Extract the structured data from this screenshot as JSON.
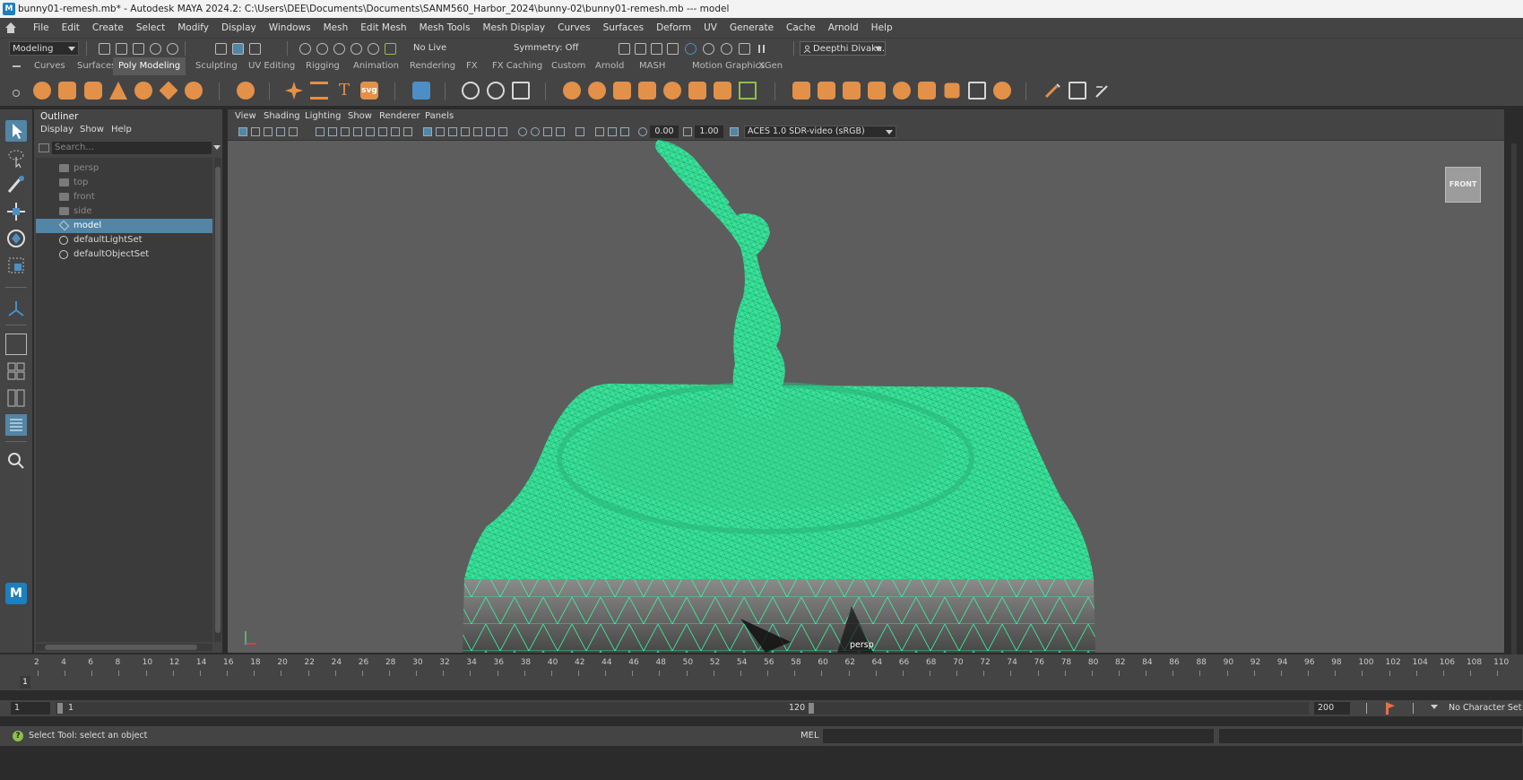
{
  "window": {
    "title": "bunny01-remesh.mb* - Autodesk MAYA 2024.2: C:\\Users\\DEE\\Documents\\Documents\\SANM560_Harbor_2024\\bunny-02\\bunny01-remesh.mb   ---   model"
  },
  "menubar": {
    "items": [
      "File",
      "Edit",
      "Create",
      "Select",
      "Modify",
      "Display",
      "Windows",
      "Mesh",
      "Edit Mesh",
      "Mesh Tools",
      "Mesh Display",
      "Curves",
      "Surfaces",
      "Deform",
      "UV",
      "Generate",
      "Cache",
      "Arnold",
      "Help"
    ]
  },
  "statusline": {
    "menuset": "Modeling",
    "live_surface": "No Live Surface",
    "symmetry": "Symmetry: Off",
    "user": "Deepthi Divaka."
  },
  "shelf_tabs": [
    "Curves",
    "Surfaces",
    "Poly Modeling",
    "Sculpting",
    "UV Editing",
    "Rigging",
    "Animation",
    "Rendering",
    "FX",
    "FX Caching",
    "Custom",
    "Arnold",
    "MASH",
    "Motion Graphics",
    "XGen"
  ],
  "shelf_active_tab": "Poly Modeling",
  "shelf_text_icons": {
    "text_tool": "T",
    "svg_tool": "svg"
  },
  "outliner": {
    "title": "Outliner",
    "menu": [
      "Display",
      "Show",
      "Help"
    ],
    "search_placeholder": "Search...",
    "items": [
      {
        "label": "persp",
        "icon": "camera-icon"
      },
      {
        "label": "top",
        "icon": "camera-icon"
      },
      {
        "label": "front",
        "icon": "camera-icon"
      },
      {
        "label": "side",
        "icon": "camera-icon"
      },
      {
        "label": "model",
        "icon": "mesh-icon"
      },
      {
        "label": "defaultLightSet",
        "icon": "set-icon"
      },
      {
        "label": "defaultObjectSet",
        "icon": "set-icon"
      }
    ],
    "selected": "model"
  },
  "viewport": {
    "menu": [
      "View",
      "Shading",
      "Lighting",
      "Show",
      "Renderer",
      "Panels"
    ],
    "exposure": "0.00",
    "gamma": "1.00",
    "color_space": "ACES 1.0 SDR-video (sRGB)",
    "viewcube_label": "FRONT",
    "camera_label": "persp",
    "wire_color": "#3ef0a0"
  },
  "timeslider": {
    "ticks": [
      "2",
      "4",
      "6",
      "8",
      "10",
      "12",
      "14",
      "16",
      "18",
      "20",
      "22",
      "24",
      "26",
      "28",
      "30",
      "32",
      "34",
      "36",
      "38",
      "40",
      "42",
      "44",
      "46",
      "48",
      "50",
      "52",
      "54",
      "56",
      "58",
      "60",
      "62",
      "64",
      "66",
      "68",
      "70",
      "72",
      "74",
      "76",
      "78",
      "80",
      "82",
      "84",
      "86",
      "88",
      "90",
      "92",
      "94",
      "96",
      "98",
      "100",
      "102",
      "104",
      "106",
      "108",
      "110"
    ],
    "current_frame": "1"
  },
  "rangeslider": {
    "start": "1",
    "range_start": "1",
    "range_end": "120",
    "end": "200",
    "character_set": "No Character Set"
  },
  "cmdline": {
    "help_text": "Select Tool: select an object",
    "lang": "MEL"
  },
  "toolbox": {
    "logo_text": "M"
  }
}
